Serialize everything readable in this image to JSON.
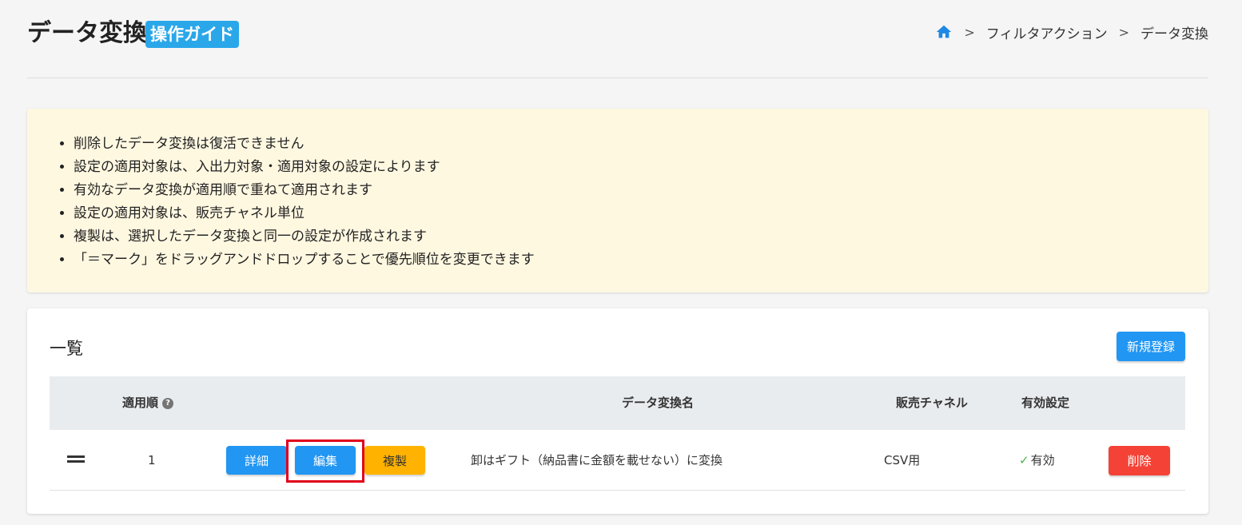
{
  "header": {
    "title": "データ変換",
    "guide_label": "操作ガイド",
    "breadcrumb": {
      "home_icon": "home-icon",
      "separator": ">",
      "items": [
        "フィルタアクション",
        "データ変換"
      ]
    }
  },
  "notice": {
    "items": [
      "削除したデータ変換は復活できません",
      "設定の適用対象は、入出力対象・適用対象の設定によります",
      "有効なデータ変換が適用順で重ねて適用されます",
      "設定の適用対象は、販売チャネル単位",
      "複製は、選択したデータ変換と同一の設定が作成されます",
      "「＝マーク」をドラッグアンドドロップすることで優先順位を変更できます"
    ]
  },
  "list": {
    "title": "一覧",
    "new_button": "新規登録",
    "columns": {
      "order": "適用順",
      "name": "データ変換名",
      "channel": "販売チャネル",
      "enabled": "有効設定"
    },
    "rows": [
      {
        "order": "1",
        "detail_button": "詳細",
        "edit_button": "編集",
        "copy_button": "複製",
        "name": "卸はギフト（納品書に金額を載せない）に変換",
        "channel": "CSV用",
        "enabled_mark": "✓",
        "enabled": "有効",
        "delete_button": "削除"
      }
    ]
  },
  "colors": {
    "primary": "#2196f3",
    "warning": "#ffb300",
    "danger": "#f44336",
    "notice_bg": "#fff8e1",
    "highlight": "#e0001a"
  }
}
